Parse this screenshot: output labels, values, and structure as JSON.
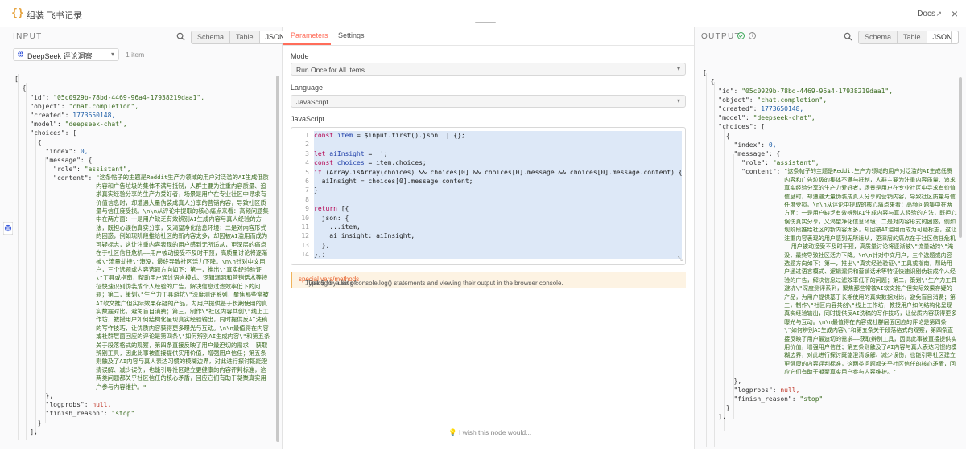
{
  "header": {
    "title": "组装 飞书记录",
    "docs_label": "Docs",
    "ext_glyph": "↗",
    "close_glyph": "×"
  },
  "input": {
    "label": "INPUT",
    "view_tabs": [
      "Schema",
      "Table",
      "JSON"
    ],
    "active_tab": "JSON",
    "node_select": "DeepSeek 评论洞察",
    "item_count": "1 item"
  },
  "output": {
    "label": "OUTPUT",
    "view_tabs": [
      "Schema",
      "Table",
      "JSON"
    ],
    "active_tab": "JSON"
  },
  "json_data": {
    "id": "\"05c0929b-78bd-4469-96a4-17938219daa1\",",
    "object": "\"chat.completion\",",
    "created": "1773650148,",
    "model": "\"deepseek-chat\",",
    "index": "0,",
    "role": "\"assistant\",",
    "content": "\"这条帖子的主题是Reddit生产力领域的用户对泛滥的AI生成低质内容和广告垃圾的集体不满与抵制，人群主要为注重内容质量、追求真实经验分享的生产力爱好者，场景是用户在专业社区中寻求有价值信息时，却遭遇大量伪装成真人分享的营销内容，导致社区质量与信任度受损。\\n\\n从评论中提取的核心痛点来看：高频问题集中在两方面：一是用户缺乏有效辨别AI生成内容与真人经验的方法，既担心误伤真实分享，又渴望净化信息环境；二是对内容形式的困惑，例如现阶段推给社区的新内容太多，却因被AI滥用而成为可疑标志，这让注重内容表现的用户感到无所适从，更深层的痛点在于社区信任危机——用户被动接受不及时干预，高质量讨论将逐渐被\\\"流量劫持\\\"淹没，最终导致社区活力下降。\\n\\n针对中文用户，三个选题或内容选题方向如下：第一，推出\\\"真实经验验证\\\"工具或指南，帮助用户通过语言模式、逻辑漏洞和营销话术等特征快速识别伪装成个人经验的广告，解决信息过滤效率低下的问题；第二，策划\\\"生产力工具避坑\\\"深度测评系列，聚焦那些常被AI软文推广但实际效果存疑的产品，为用户提供基于长期使用的真实数据对比，避免盲目消费；第三，制作\\\"社区内容共创\\\"线上工作坊，教授用户如何结构化呈现真实经验输出，同时提供反AI洗稿的写作技巧，让优质内容获得更多曝光与互动。\\n\\n最值得在内容或社群层面回应的评论是第四条\\\"如何辨别AI生成内容\\\"和第五条关于段落格式的观察，第四条直接反映了用户最迫切的需求——获取辨别工具，因此此事被直接提供实用价值，增强用户信任；第五条则触及了AI内容与真人表达习惯的模糊边界，对此进行探讨既能澄清误解、减少误伤，也能引导社区建立更健康的内容评判标准，这两类问题都关乎社区信任的核心矛盾，回应它们有助于凝聚真实用户参与内容维护。\"",
    "logprobs": "null,",
    "finish_reason": "\"stop\""
  },
  "params": {
    "tabs": [
      "Parameters",
      "Settings"
    ],
    "mode_label": "Mode",
    "mode_value": "Run Once for All Items",
    "language_label": "Language",
    "language_value": "JavaScript",
    "js_label": "JavaScript",
    "line_numbers": [
      "1",
      "2",
      "3",
      "4",
      "5",
      "6",
      "7",
      "8",
      "9",
      "10",
      "11",
      "12",
      "13",
      "14"
    ],
    "hint_pre": "Type $ for a list of ",
    "hint_link": "special vars/methods",
    "hint_post": ". Debug by using console.log() statements and viewing their output in the browser console.",
    "wish": "I wish this node would..."
  },
  "colors": {
    "accent": "#ff6d5a",
    "string": "#3a6b1f",
    "number": "#1f5fa8",
    "success": "#3aa757"
  }
}
